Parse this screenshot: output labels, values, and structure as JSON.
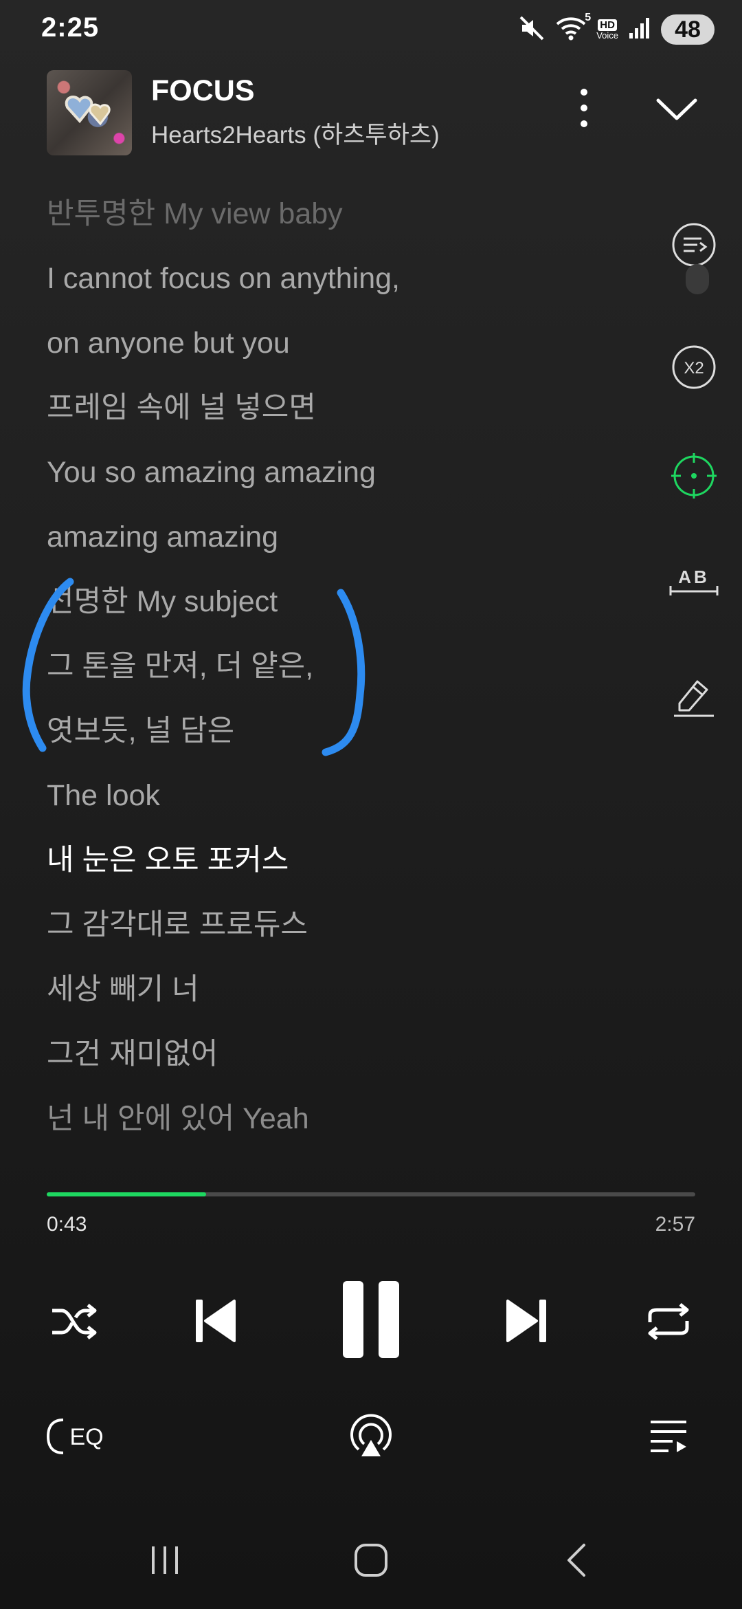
{
  "status_bar": {
    "time": "2:25",
    "battery": "48",
    "hd_label": "HD",
    "voice_label": "Voice",
    "network_badge": "5"
  },
  "header": {
    "title": "FOCUS",
    "artist": "Hearts2Hearts (하츠투하츠)"
  },
  "lyrics": [
    "반투명한 My view baby",
    "I cannot focus on anything,",
    "on anyone but you",
    "프레임 속에 널 넣으면",
    "You so amazing amazing",
    "amazing amazing",
    "선명한 My subject",
    "그 톤을 만져, 더 얕은,",
    "엿보듯, 널 담은",
    "The look",
    "내 눈은 오토 포커스",
    "그 감각대로 프로듀스",
    "세상 빼기 너",
    "그건 재미없어",
    "넌 내 안에 있어 Yeah"
  ],
  "active_lyric_index": 10,
  "side_tools": {
    "speed_label": "X2",
    "ab_label": "AB"
  },
  "playback": {
    "current_time": "0:43",
    "total_time": "2:57",
    "progress": 0.246
  },
  "bottom_actions": {
    "eq_label": "EQ"
  },
  "colors": {
    "accent": "#1ed760",
    "annotation": "#2d8bf0",
    "background": "#1c1c1c"
  }
}
